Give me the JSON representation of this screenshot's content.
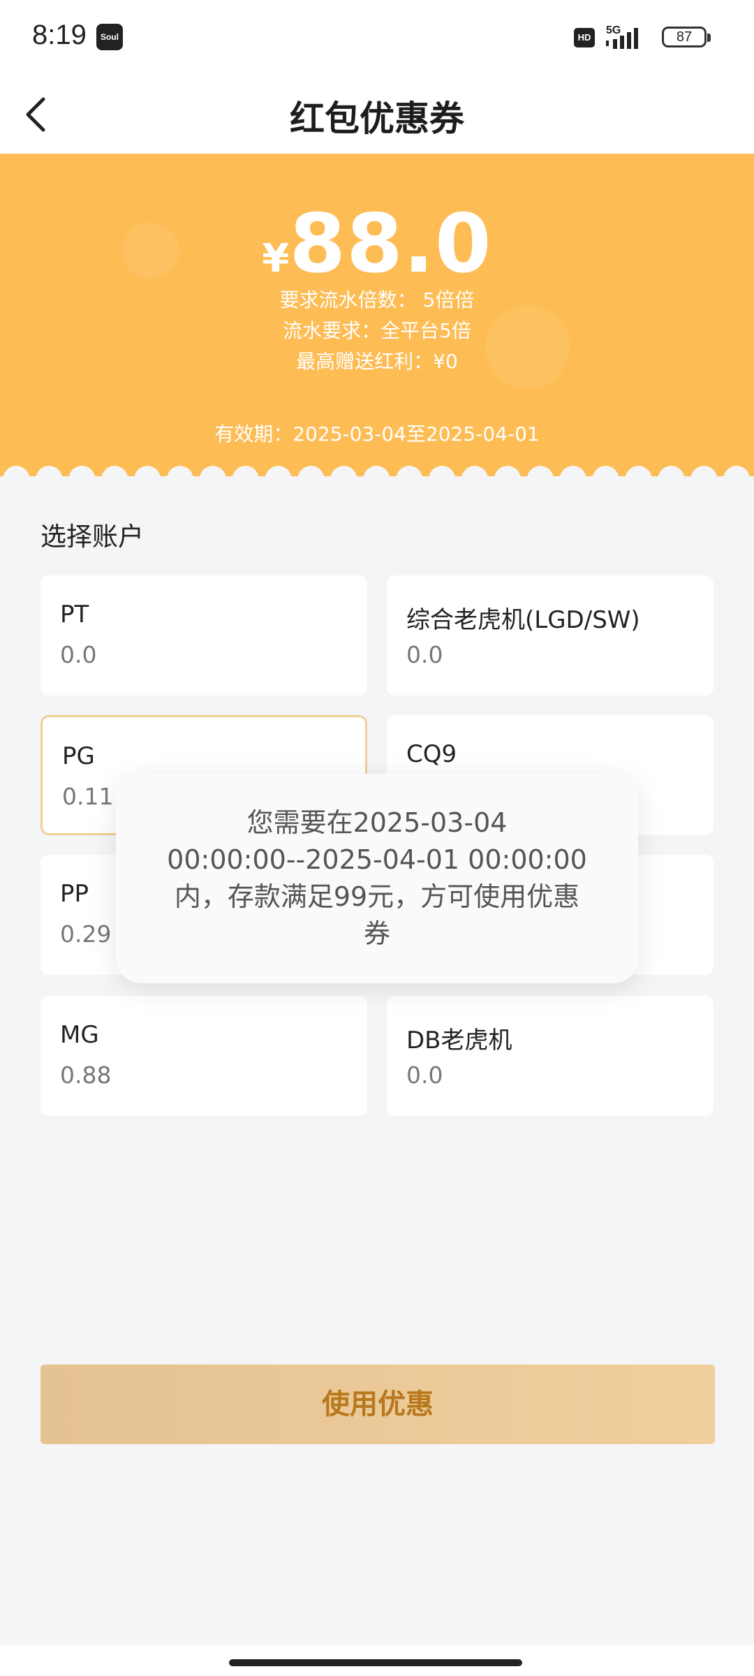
{
  "status_bar": {
    "time": "8:19",
    "app_badge": "Soul",
    "hd": "HD",
    "network": "5G",
    "battery": "87"
  },
  "header": {
    "title": "红包优惠券"
  },
  "coupon": {
    "currency": "¥",
    "amount": "88.0",
    "turnover_multiple": "要求流水倍数： 5倍倍",
    "turnover_requirement": "流水要求：全平台5倍",
    "max_bonus": "最高赠送红利：¥0",
    "validity": "有效期：2025-03-04至2025-04-01"
  },
  "accounts": {
    "section_title": "选择账户",
    "items": [
      {
        "name": "PT",
        "balance": "0.0"
      },
      {
        "name": "综合老虎机(LGD/SW)",
        "balance": "0.0"
      },
      {
        "name": "PG",
        "balance": "0.11"
      },
      {
        "name": "CQ9",
        "balance": ""
      },
      {
        "name": "PP",
        "balance": "0.29"
      },
      {
        "name": "",
        "balance": ""
      },
      {
        "name": "MG",
        "balance": "0.88"
      },
      {
        "name": "DB老虎机",
        "balance": "0.0"
      }
    ]
  },
  "toast": {
    "line1": "您需要在2025-03-04",
    "line2": "00:00:00--2025-04-01 00:00:00",
    "line3": "内，存款满足99元，方可使用优惠",
    "line4": "券"
  },
  "actions": {
    "use_label": "使用优惠"
  },
  "colors": {
    "banner": "#fdbc54",
    "button_gradient_start": "#e5c292",
    "button_text": "#b8781c",
    "selected_border": "#f1cf95"
  }
}
